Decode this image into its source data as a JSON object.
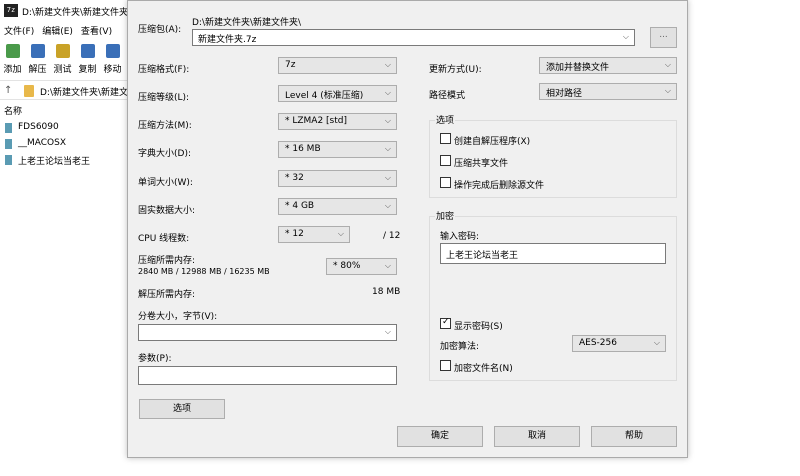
{
  "file_manager": {
    "app_icon": "7z",
    "title": "D:\\新建文件夹\\新建文件夹",
    "menu": [
      "文件(F)",
      "编辑(E)",
      "查看(V)"
    ],
    "toolbar": [
      {
        "label": "添加",
        "icon": "add-icon",
        "color": "#4a9a4a"
      },
      {
        "label": "解压",
        "icon": "extract-icon",
        "color": "#3a6fb8"
      },
      {
        "label": "测试",
        "icon": "test-icon",
        "color": "#c9a227"
      },
      {
        "label": "复制",
        "icon": "copy-icon",
        "color": "#3a6fb8"
      },
      {
        "label": "移动",
        "icon": "move-icon",
        "color": "#3a6fb8"
      }
    ],
    "address": "D:\\新建文件夹\\新建文件夹\\",
    "column_name": "名称",
    "files": [
      "FDS6090",
      "__MACOSX",
      "上老王论坛当老王"
    ]
  },
  "dialog": {
    "archive_label": "压缩包(A):",
    "archive_path": "D:\\新建文件夹\\新建文件夹\\",
    "archive_name": "新建文件夹.7z",
    "browse_label": "...",
    "left_fields": {
      "format": {
        "label": "压缩格式(F):",
        "value": "7z"
      },
      "level": {
        "label": "压缩等级(L):",
        "value": "Level 4 (标准压缩)"
      },
      "method": {
        "label": "压缩方法(M):",
        "value": "* LZMA2 [std]"
      },
      "dict": {
        "label": "字典大小(D):",
        "value": "* 16 MB"
      },
      "word": {
        "label": "单词大小(W):",
        "value": "* 32"
      },
      "solid": {
        "label": "固实数据大小:",
        "value": "* 4 GB"
      },
      "threads": {
        "label": "CPU 线程数:",
        "value": "* 12",
        "max": "/ 12"
      },
      "mem_comp": {
        "label": "压缩所需内存:",
        "detail": "2840 MB / 12988 MB / 16235 MB",
        "value": "* 80%"
      },
      "mem_decomp": {
        "label": "解压所需内存:",
        "value": "18 MB"
      },
      "split": {
        "label": "分卷大小，字节(V):",
        "value": ""
      },
      "params": {
        "label": "参数(P):",
        "value": ""
      }
    },
    "options_button": "选项",
    "update": {
      "label": "更新方式(U):",
      "value": "添加并替换文件"
    },
    "path_mode": {
      "label": "路径模式",
      "value": "相对路径"
    },
    "options_group": {
      "title": "选项",
      "items": [
        {
          "label": "创建自解压程序(X)",
          "checked": false
        },
        {
          "label": "压缩共享文件",
          "checked": false
        },
        {
          "label": "操作完成后删除源文件",
          "checked": false
        }
      ]
    },
    "encryption": {
      "title": "加密",
      "password_label": "输入密码:",
      "password_value": "上老王论坛当老王",
      "show_password": {
        "label": "显示密码(S)",
        "checked": true
      },
      "method_label": "加密算法:",
      "method_value": "AES-256",
      "encrypt_names": {
        "label": "加密文件名(N)",
        "checked": false
      }
    },
    "buttons": {
      "ok": "确定",
      "cancel": "取消",
      "help": "帮助"
    }
  }
}
